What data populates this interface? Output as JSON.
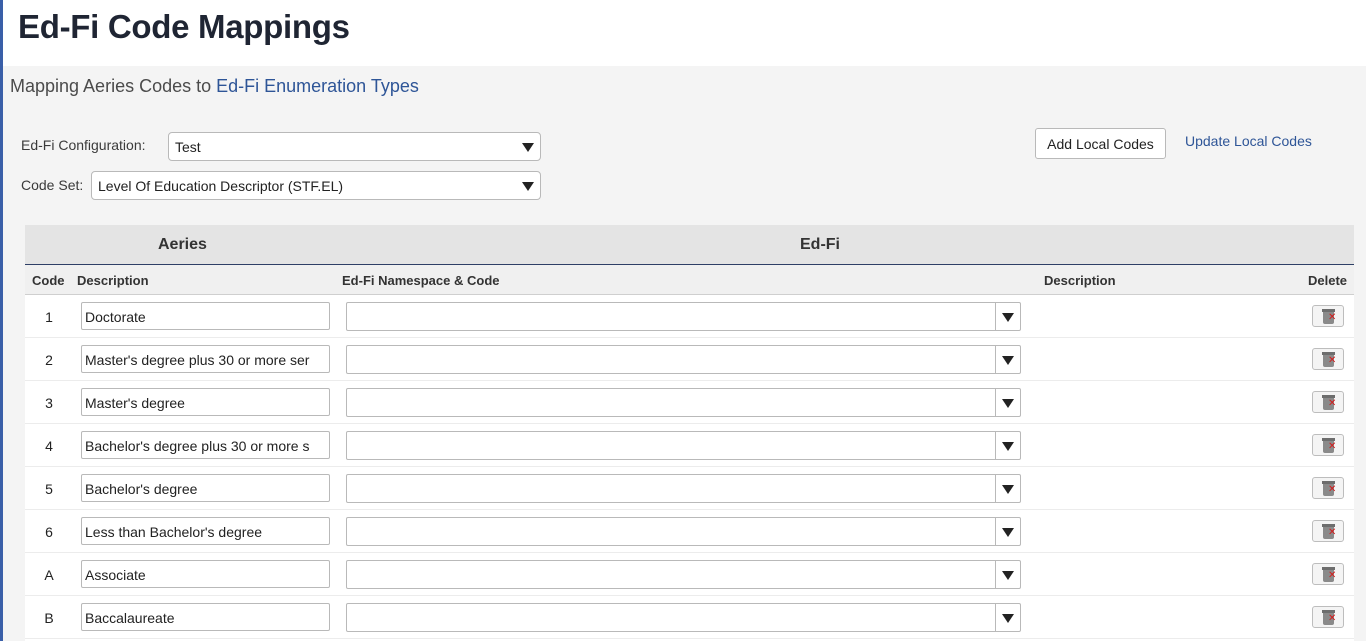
{
  "page": {
    "title": "Ed-Fi Code Mappings",
    "subtitle_prefix": "Mapping Aeries Codes to ",
    "subtitle_link": "Ed-Fi Enumeration Types"
  },
  "filters": {
    "config_label": "Ed-Fi Configuration:",
    "config_value": "Test",
    "codeset_label": "Code Set:",
    "codeset_value": "Level Of Education Descriptor (STF.EL)"
  },
  "actions": {
    "add_local_codes": "Add Local Codes",
    "update_local_codes": "Update Local Codes"
  },
  "grid": {
    "group_aeries": "Aeries",
    "group_edfi": "Ed-Fi",
    "columns": {
      "code": "Code",
      "description": "Description",
      "namespace": "Ed-Fi Namespace & Code",
      "edfi_description": "Description",
      "delete": "Delete"
    },
    "rows": [
      {
        "code": "1",
        "description": "Doctorate"
      },
      {
        "code": "2",
        "description": "Master's degree plus 30 or more ser"
      },
      {
        "code": "3",
        "description": "Master's degree"
      },
      {
        "code": "4",
        "description": "Bachelor's degree plus 30 or more s"
      },
      {
        "code": "5",
        "description": "Bachelor's degree"
      },
      {
        "code": "6",
        "description": "Less than Bachelor's degree"
      },
      {
        "code": "A",
        "description": "Associate"
      },
      {
        "code": "B",
        "description": "Baccalaureate"
      }
    ]
  },
  "colors": {
    "accent": "#3a5fa8",
    "link": "#2e5597",
    "delete_x": "#d21c1c"
  },
  "icons": {
    "dropdown": "triangle-down",
    "delete": "trash-can-red-x"
  }
}
